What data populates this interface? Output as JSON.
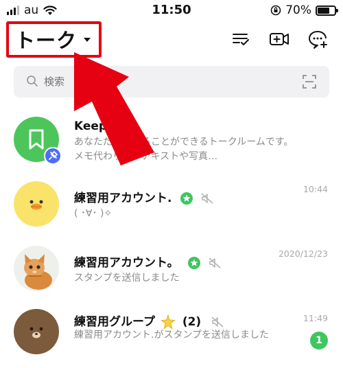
{
  "status_bar": {
    "carrier": "au",
    "time": "11:50",
    "battery_text": "70%",
    "battery_level": 0.7
  },
  "header": {
    "title": "トーク"
  },
  "search": {
    "placeholder": "検索"
  },
  "chats": [
    {
      "name": "Keep",
      "preview": "あなただけが見ることができるトークルームです。メモ代わりに、テキストや写真…",
      "time": "",
      "avatar": "keep-bookmark-icon"
    },
    {
      "name": "練習用アカウント.",
      "preview": "( ･∀･ )✧",
      "time": "10:44",
      "avatar": "duck-avatar"
    },
    {
      "name": "練習用アカウント。",
      "preview": "スタンプを送信しました",
      "time": "2020/12/23",
      "avatar": "kitten-photo"
    },
    {
      "name": "練習用グループ",
      "member_count": "(2)",
      "preview": "練習用アカウント.がスタンプを送信しました",
      "time": "11:49",
      "unread": "1",
      "avatar": "brown-bear-avatar"
    }
  ],
  "colors": {
    "accent_green": "#3ec65f",
    "highlight_red": "#e50012"
  }
}
